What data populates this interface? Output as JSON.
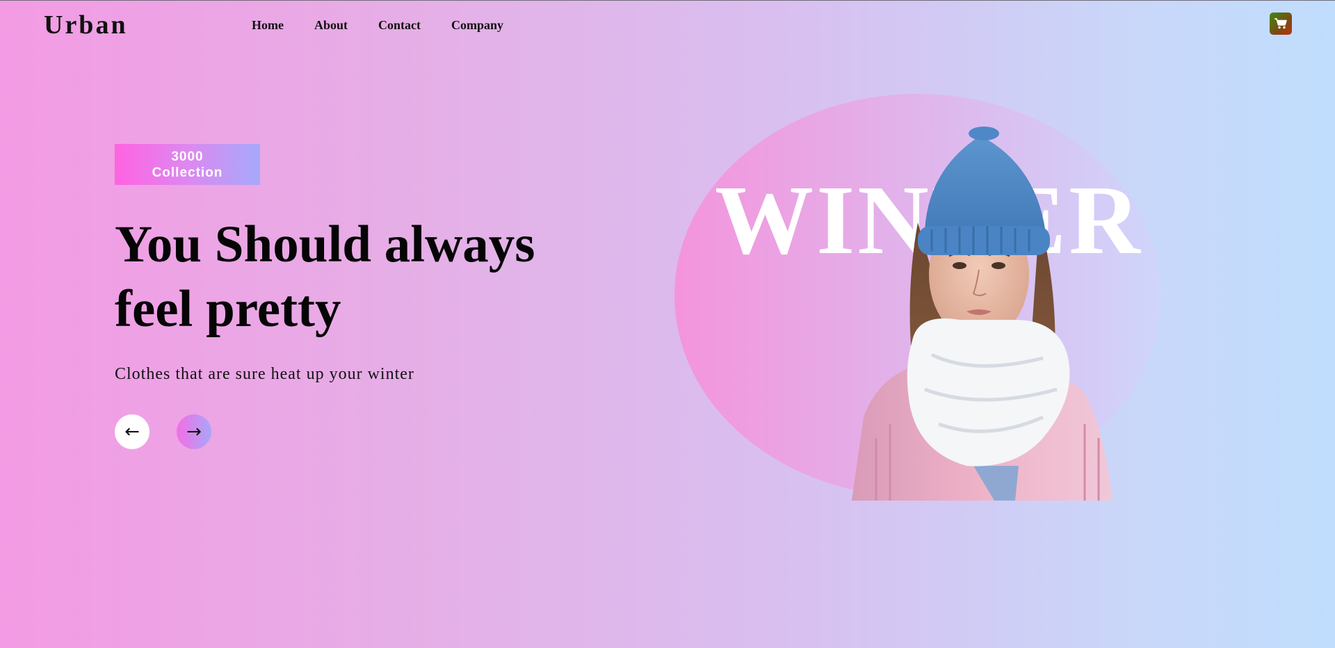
{
  "brand": {
    "logo": "Urban"
  },
  "nav": {
    "items": [
      {
        "label": "Home"
      },
      {
        "label": "About"
      },
      {
        "label": "Contact"
      },
      {
        "label": "Company"
      }
    ]
  },
  "cart": {
    "icon": "shopping-cart-icon",
    "color": "#3f8a12"
  },
  "hero": {
    "badge_line1": "3000",
    "badge_line2": "Collection",
    "headline": "You Should always feel pretty",
    "subtitle": "Clothes that are sure heat up your winter",
    "prev_icon": "←",
    "next_icon": "→",
    "background_word": "WINTER"
  },
  "colors": {
    "bg_left": "#f39be4",
    "bg_right": "#c0ddfd",
    "badge_start": "#ff63e1",
    "badge_end": "#a6a9fb"
  }
}
